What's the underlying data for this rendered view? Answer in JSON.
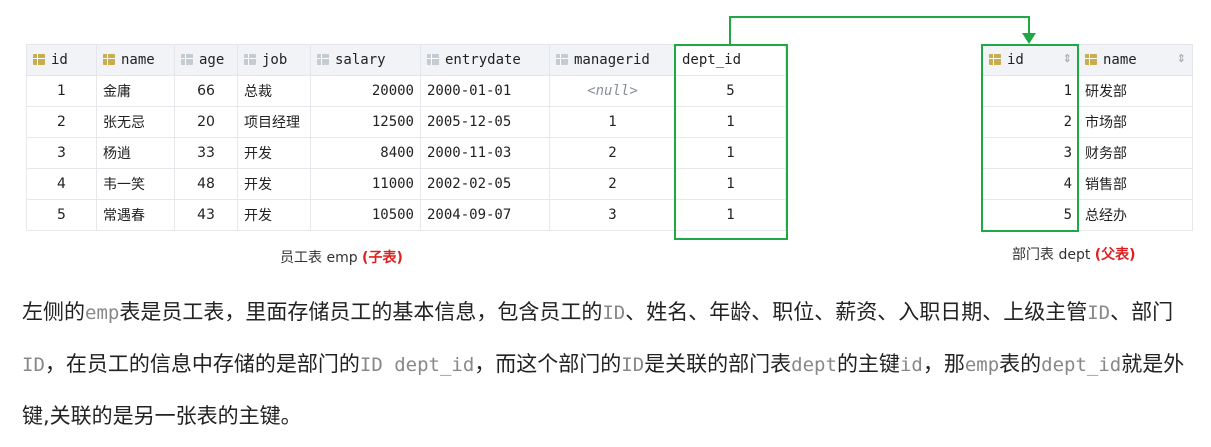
{
  "emp_table": {
    "columns": [
      "id",
      "name",
      "age",
      "job",
      "salary",
      "entrydate",
      "managerid",
      "dept_id"
    ],
    "rows": [
      [
        "1",
        "金庸",
        "66",
        "总裁",
        "20000",
        "2000-01-01",
        "<null>",
        "5"
      ],
      [
        "2",
        "张无忌",
        "20",
        "项目经理",
        "12500",
        "2005-12-05",
        "1",
        "1"
      ],
      [
        "3",
        "杨逍",
        "33",
        "开发",
        "8400",
        "2000-11-03",
        "2",
        "1"
      ],
      [
        "4",
        "韦一笑",
        "48",
        "开发",
        "11000",
        "2002-02-05",
        "2",
        "1"
      ],
      [
        "5",
        "常遇春",
        "43",
        "开发",
        "10500",
        "2004-09-07",
        "3",
        "1"
      ]
    ],
    "caption": "员工表 emp",
    "caption_tag": "(子表)"
  },
  "dept_table": {
    "columns": [
      "id",
      "name"
    ],
    "rows": [
      [
        "1",
        "研发部"
      ],
      [
        "2",
        "市场部"
      ],
      [
        "3",
        "财务部"
      ],
      [
        "4",
        "销售部"
      ],
      [
        "5",
        "总经办"
      ]
    ],
    "caption": "部门表 dept",
    "caption_tag": "(父表)"
  },
  "paragraph": {
    "s1": "左侧的",
    "c1": "emp",
    "s2": "表是员工表，里面存储员工的基本信息，包含员工的",
    "c2": "ID",
    "s3": "、姓名、年龄、职位、薪资、入职日期、上级主管",
    "c3": "ID",
    "s4": "、部门",
    "c4": "ID",
    "s5": "，在员工的信息中存储的是部门的",
    "c5": "ID dept_id",
    "s6": "，而这个部门的",
    "c6": "ID",
    "s7": "是关联的部门表",
    "c7": "dept",
    "s8": "的主键",
    "c8": "id",
    "s9": "，那",
    "c9": "emp",
    "s10": "表的",
    "c10": "dept_id",
    "s11": "就是外键,关联的是另一张表的主键。"
  },
  "colors": {
    "highlight": "#21a846",
    "tag": "#e02020"
  }
}
